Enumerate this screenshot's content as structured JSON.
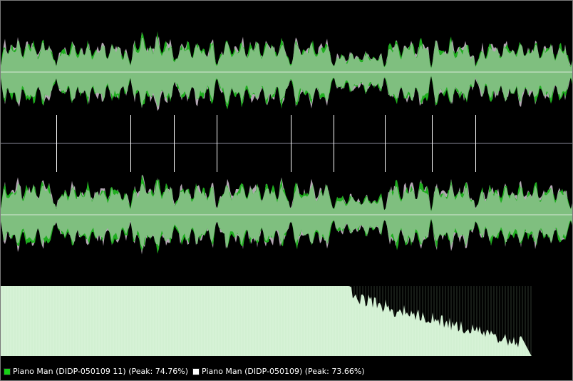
{
  "colors": {
    "background": "#000000",
    "waveform_fill": "#7fbf7f",
    "waveform_peak_primary": "#1fae1f",
    "waveform_peak_secondary": "#c8b8c8",
    "center_line": "#d8e8d8",
    "divider_line": "#8a8a9a",
    "marker_line": "#ffffff",
    "spectrum_fill": "#d6f2d6",
    "legend_text": "#ffffff",
    "legend_swatch_primary": "#17d117",
    "legend_swatch_secondary": "#ffffff"
  },
  "legend": {
    "items": [
      {
        "label": "Piano Man (DIDP-050109 11) (Peak: 74.76%)",
        "swatch": "#17d117"
      },
      {
        "label": "Piano Man (DIDP-050109) (Peak: 73.66%)",
        "swatch": "#ffffff"
      }
    ]
  }
}
